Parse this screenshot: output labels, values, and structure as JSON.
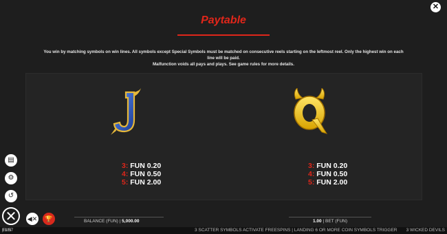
{
  "title": "Paytable",
  "intro_line1": "You win by matching symbols on win lines. All symbols except Special Symbols must be matched on consecutive reels starting on the leftmost reel. Only the highest win on each line will be paid.",
  "intro_line2": "Malfunction voids all pays and plays. See game rules for more details.",
  "symbols": [
    {
      "name": "J",
      "pays": [
        {
          "count": "3:",
          "value": "FUN 0.20"
        },
        {
          "count": "4:",
          "value": "FUN 0.50"
        },
        {
          "count": "5:",
          "value": "FUN 2.00"
        }
      ]
    },
    {
      "name": "Q",
      "pays": [
        {
          "count": "3:",
          "value": "FUN 0.20"
        },
        {
          "count": "4:",
          "value": "FUN 0.50"
        },
        {
          "count": "5:",
          "value": "FUN 2.00"
        }
      ]
    }
  ],
  "balance": {
    "label": "BALANCE (FUN)",
    "sep": "|",
    "value": "5,000.00"
  },
  "bet": {
    "value": "1.00",
    "sep": "|",
    "label": "BET (FUN)"
  },
  "status": {
    "time": "13:57",
    "sep": "|",
    "mode": "FUN",
    "message": "3 SCATTER SYMBOLS ACTIVATE FREESPINS | LANDING 6 OR MORE COIN SYMBOLS TRIGGER",
    "game_name": "3 WICKED DEVILS"
  },
  "icons": {
    "close": "close-icon",
    "history": "history-icon",
    "settings": "gear-icon",
    "paytable": "document-icon",
    "exit": "x-icon",
    "sound": "speaker-mute-icon",
    "trophy": "trophy-icon"
  },
  "colors": {
    "accent": "#e0261a",
    "background": "#1e1e1e",
    "panel": "#242424",
    "symbol_j": "#1f4fb0",
    "symbol_q": "#f2c200"
  }
}
